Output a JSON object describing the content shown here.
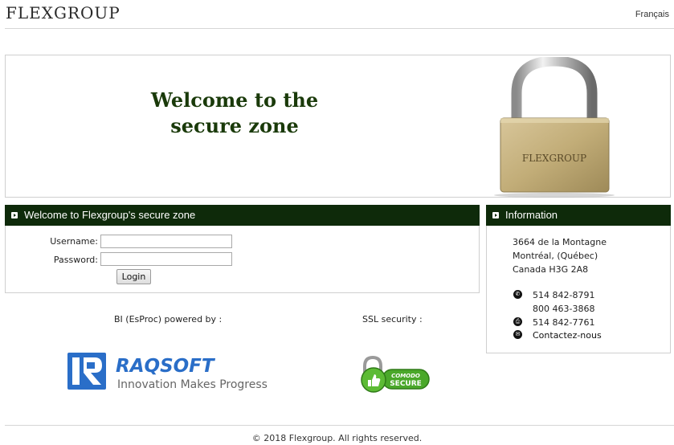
{
  "header": {
    "logo_text": "FLEXGROUP",
    "language_link": "Français"
  },
  "banner": {
    "welcome_line1": "Welcome to the",
    "welcome_line2": "secure zone",
    "lock_label": "FLEXGROUP"
  },
  "login": {
    "title": "Welcome to Flexgroup's secure zone",
    "username_label": "Username:",
    "username_value": "",
    "password_label": "Password:",
    "password_value": "",
    "button_label": "Login"
  },
  "info": {
    "title": "Information",
    "address_lines": [
      "3664 de la Montagne",
      "Montréal, (Québec)",
      "Canada H3G 2A8"
    ],
    "phone1": "514 842-8791",
    "phone2": "800 463-3868",
    "fax": "514 842-7761",
    "contact_link": "Contactez-nous"
  },
  "powered": {
    "bi_caption": "BI (EsProc) powered by :",
    "ssl_caption": "SSL security :",
    "raqsoft_name": "RAQSOFT",
    "raqsoft_tagline": "Innovation Makes Progress",
    "comodo_top": "COMODO",
    "comodo_bottom": "SECURE"
  },
  "footer": {
    "copyright": "© 2018 Flexgroup. All rights reserved."
  },
  "colors": {
    "panel_header": "#0e2a0a",
    "welcome_text": "#1a3a0a",
    "raqsoft_blue": "#2a6ec8",
    "comodo_green": "#4aa82a"
  }
}
